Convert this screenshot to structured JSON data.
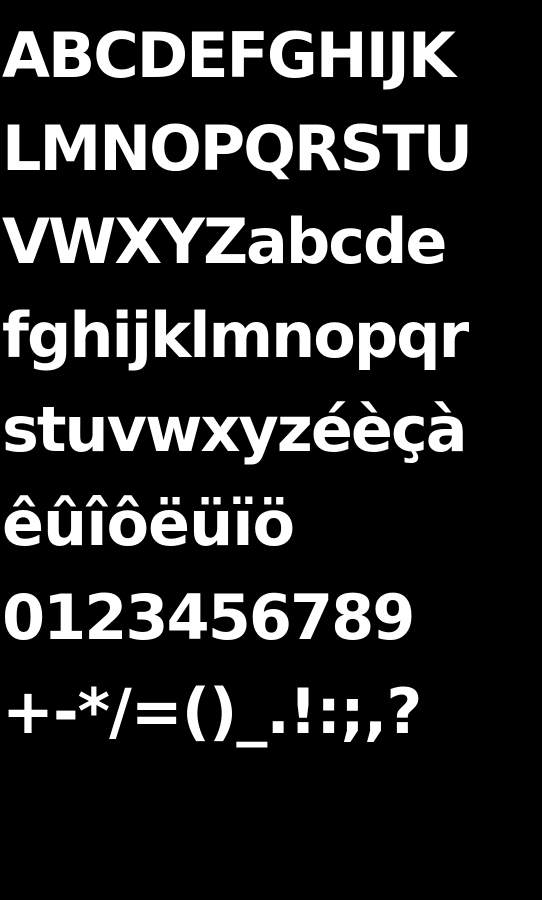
{
  "specimen": {
    "background": "#000000",
    "text_color": "#ffffff",
    "lines": [
      "ABCDEFGHIJK",
      "LMNOPQRSTU",
      "VWXYZabcde",
      "fghijklmnopqr",
      "stuvwxyzéèçà",
      "êûîôëüïö",
      "0123456789",
      "+-*/=()_.!:;,?"
    ]
  }
}
